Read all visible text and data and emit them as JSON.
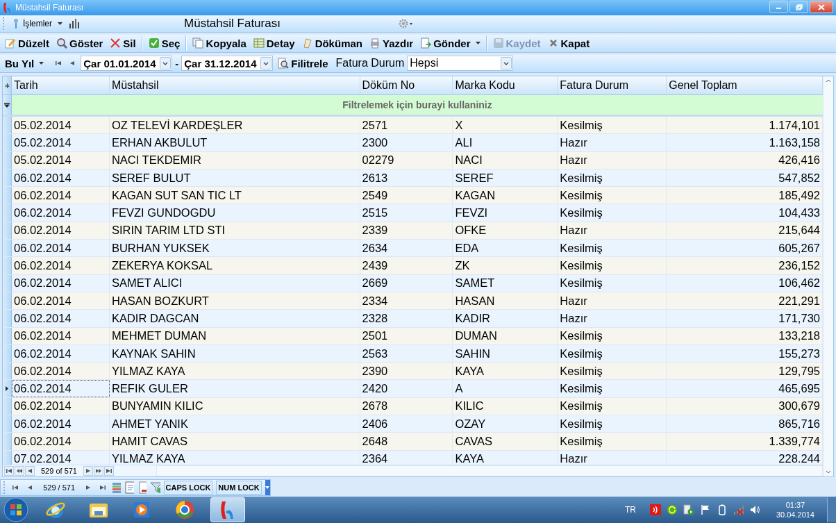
{
  "window": {
    "title": "Müstahsil Faturası"
  },
  "top_bar": {
    "menu_label": "İşlemler",
    "title": "Müstahsil Faturası"
  },
  "action_groups": [
    [
      {
        "label": "Düzelt",
        "disabled": false,
        "has_menu": false
      },
      {
        "label": "Göster",
        "disabled": false,
        "has_menu": false
      },
      {
        "label": "Sil",
        "disabled": false,
        "has_menu": false
      }
    ],
    [
      {
        "label": "Seç",
        "disabled": false,
        "has_menu": false
      }
    ],
    [
      {
        "label": "Kopyala",
        "disabled": false,
        "has_menu": false
      },
      {
        "label": "Detay",
        "disabled": false,
        "has_menu": false
      },
      {
        "label": "Döküman",
        "disabled": false,
        "has_menu": false
      },
      {
        "label": "Yazdır",
        "disabled": false,
        "has_menu": false
      },
      {
        "label": "Gönder",
        "disabled": false,
        "has_menu": true
      }
    ],
    [
      {
        "label": "Kaydet",
        "disabled": true,
        "has_menu": false
      },
      {
        "label": "Kapat",
        "disabled": false,
        "has_menu": false
      }
    ]
  ],
  "filter_bar": {
    "period": "Bu Yıl",
    "start_date": "Çar 01.01.2014",
    "dash": "-",
    "end_date": "Çar 31.12.2014",
    "filter_button": "Filitrele",
    "status_label": "Fatura Durum",
    "status_value": "Hepsi"
  },
  "table": {
    "columns": [
      "Tarih",
      "Müstahsil",
      "Döküm No",
      "Marka Kodu",
      "Fatura Durum",
      "Genel Toplam"
    ],
    "filter_row": "Filtrelemek için burayi kullaniniz",
    "rows": [
      {
        "cells": [
          "05.02.2014",
          "OZ TELEVİ KARDEŞLER",
          "2571",
          "X",
          "Kesilmiş",
          "1.174,101"
        ],
        "selected": false
      },
      {
        "cells": [
          "05.02.2014",
          "ERHAN AKBULUT",
          "2300",
          "ALI",
          "Hazır",
          "1.163,158"
        ],
        "selected": false
      },
      {
        "cells": [
          "05.02.2014",
          "NACI TEKDEMIR",
          "02279",
          "NACI",
          "Hazır",
          "426,416"
        ],
        "selected": false
      },
      {
        "cells": [
          "06.02.2014",
          "SEREF BULUT",
          "2613",
          "SEREF",
          "Kesilmiş",
          "547,852"
        ],
        "selected": false
      },
      {
        "cells": [
          "06.02.2014",
          "KAGAN SUT SAN TIC LT",
          "2549",
          "KAGAN",
          "Kesilmiş",
          "185,492"
        ],
        "selected": false
      },
      {
        "cells": [
          "06.02.2014",
          "FEVZI GUNDOGDU",
          "2515",
          "FEVZI",
          "Kesilmiş",
          "104,433"
        ],
        "selected": false
      },
      {
        "cells": [
          "06.02.2014",
          "SIRIN TARIM LTD STI",
          "2339",
          "OFKE",
          "Hazır",
          "215,644"
        ],
        "selected": false
      },
      {
        "cells": [
          "06.02.2014",
          "BURHAN YUKSEK",
          "2634",
          "EDA",
          "Kesilmiş",
          "605,267"
        ],
        "selected": false
      },
      {
        "cells": [
          "06.02.2014",
          "ZEKERYA KOKSAL",
          "2439",
          "ZK",
          "Kesilmiş",
          "236,152"
        ],
        "selected": false
      },
      {
        "cells": [
          "06.02.2014",
          "SAMET ALICI",
          "2669",
          "SAMET",
          "Kesilmiş",
          "106,462"
        ],
        "selected": false
      },
      {
        "cells": [
          "06.02.2014",
          "HASAN BOZKURT",
          "2334",
          "HASAN",
          "Hazır",
          "221,291"
        ],
        "selected": false
      },
      {
        "cells": [
          "06.02.2014",
          "KADIR DAGCAN",
          "2328",
          "KADIR",
          "Hazır",
          "171,730"
        ],
        "selected": false
      },
      {
        "cells": [
          "06.02.2014",
          "MEHMET DUMAN",
          "2501",
          "DUMAN",
          "Kesilmiş",
          "133,218"
        ],
        "selected": false
      },
      {
        "cells": [
          "06.02.2014",
          "KAYNAK SAHIN",
          "2563",
          "SAHIN",
          "Kesilmiş",
          "155,273"
        ],
        "selected": false
      },
      {
        "cells": [
          "06.02.2014",
          "YILMAZ KAYA",
          "2390",
          "KAYA",
          "Kesilmiş",
          "129,795"
        ],
        "selected": false
      },
      {
        "cells": [
          "06.02.2014",
          "REFIK GULER",
          "2420",
          "A",
          "Kesilmiş",
          "465,695"
        ],
        "selected": true
      },
      {
        "cells": [
          "06.02.2014",
          "BUNYAMIN KILIC",
          "2678",
          "KILIC",
          "Kesilmiş",
          "300,679"
        ],
        "selected": false
      },
      {
        "cells": [
          "06.02.2014",
          "AHMET YANIK",
          "2406",
          "OZAY",
          "Kesilmiş",
          "865,716"
        ],
        "selected": false
      },
      {
        "cells": [
          "06.02.2014",
          "HAMIT CAVAS",
          "2648",
          "CAVAS",
          "Kesilmiş",
          "1.339,774"
        ],
        "selected": false
      },
      {
        "cells": [
          "07.02.2014",
          "YILMAZ KAYA",
          "2364",
          "KAYA",
          "Hazır",
          "228.244"
        ],
        "selected": false
      }
    ]
  },
  "navigator": {
    "position": "529 of 571"
  },
  "status_bar": {
    "position": "529 / 571",
    "indicators": [
      "CAPS LOCK",
      "NUM LOCK"
    ]
  },
  "taskbar": {
    "apps": [
      {
        "active": false
      },
      {
        "active": false
      },
      {
        "active": false
      },
      {
        "active": false
      },
      {
        "active": true
      }
    ],
    "language": "TR",
    "time": "01:37",
    "date": "30.04.2014"
  }
}
